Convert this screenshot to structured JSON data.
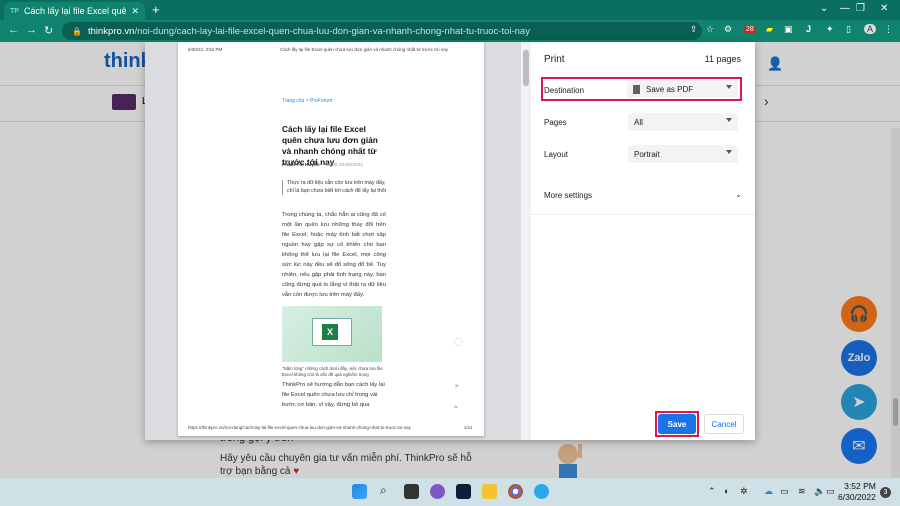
{
  "browser": {
    "tab_title": "Cách lấy lại file Excel quên chưa l",
    "tab_favicon": "TP",
    "url_domain": "thinkpro.vn",
    "url_path": "/noi-dung/cach-lay-lai-file-excel-quen-chua-luu-don-gian-va-nhanh-chong-nhat-tu-truoc-toi-nay",
    "ext_badge": "28",
    "profile_initial": "A"
  },
  "site": {
    "logo": "think",
    "category_letter": "L",
    "section_heading": "trong gọi ý trên",
    "help_text": "Hãy yêu cầu chuyên gia tư vấn miễn phí. ThinkPro sẽ hỗ trợ bạn bằng cả",
    "heart": "♥",
    "zalo_label": "Zalo"
  },
  "preview": {
    "header_date": "6/30/22, 3:52 PM",
    "header_title": "Cách lấy lại file Excel quên chưa lưu đơn giản và nhanh chóng nhất từ trước tới nay",
    "breadcrumb": "Trang chủ > ProForum",
    "article_title": "Cách lấy lại file Excel quên chưa lưu đơn giản và nhanh chóng nhất từ trước tới nay",
    "author": "Phạm Thị Huyền",
    "date": "15:05 30/06/2022",
    "quote": "Thực ra dữ liệu vẫn còn lưu trên máy đấy, chỉ là bạn chưa biết tới cách để lấy lại thôi",
    "body1": "Trong chúng ta, chắc hẳn ai cũng đã có một lần quên lưu những thay đổi trên file Excel, hoặc máy tính bất chợt sập nguồn hay gặp sự cố khiến cho bạn không thể lưu lại file Excel, mọi công sức lúc này đều sẽ đổ sông đổ bể. Tuy nhiên, nếu gặp phải tình trạng này, bạn cũng đừng quá lo lắng vì thật ra dữ liệu vẫn còn được lưu trên máy đấy.",
    "caption": "\"Năm lòng\" những cách dưới đây, việc chưa lưu file Excel không còn là vấn đề quá nghiêm trọng",
    "body2": "ThinkPro sẽ hướng dẫn bạn cách lấy lại file Excel quên chưa lưu chỉ trong vài bước cơ bản, vì vậy, đừng bỏ qua",
    "footer_url": "https://thinkpro.vn/noi-dung/cach-lay-lai-file-excel-quen-chua-luu-don-gian-va-nhanh-chong-nhat-tu-truoc-toi-nay",
    "footer_page": "1/11"
  },
  "print": {
    "title": "Print",
    "page_count": "11 pages",
    "destination_label": "Destination",
    "destination_value": "Save as PDF",
    "pages_label": "Pages",
    "pages_value": "All",
    "layout_label": "Layout",
    "layout_value": "Portrait",
    "more_settings": "More settings",
    "save": "Save",
    "cancel": "Cancel"
  },
  "taskbar": {
    "time": "3:52 PM",
    "date": "6/30/2022",
    "notif_count": "3"
  }
}
